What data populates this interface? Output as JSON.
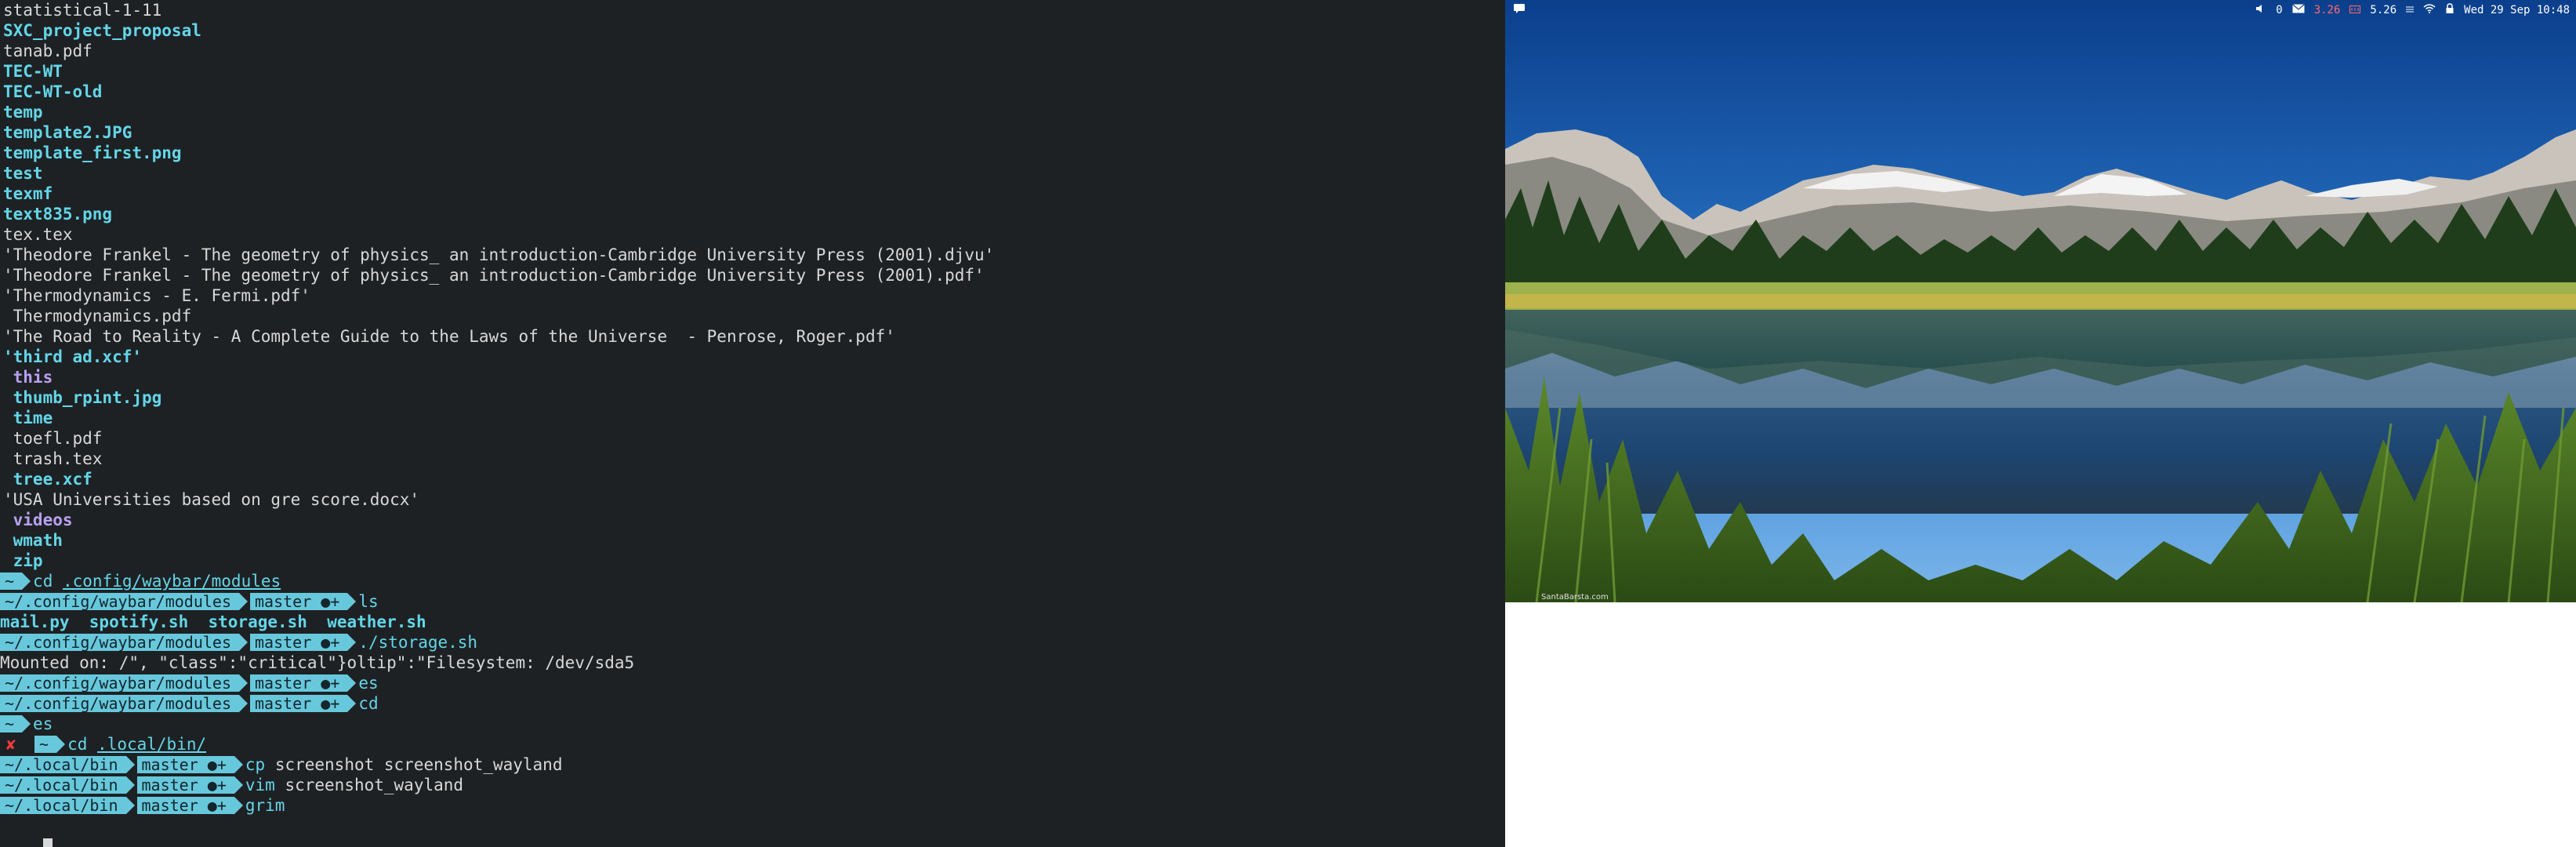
{
  "terminal": {
    "listing": [
      {
        "text": "statistical-1-11",
        "style": "white"
      },
      {
        "text": "SXC_project_proposal",
        "style": "dir"
      },
      {
        "text": "tanab.pdf",
        "style": "white"
      },
      {
        "text": "TEC-WT",
        "style": "dir"
      },
      {
        "text": "TEC-WT-old",
        "style": "dir"
      },
      {
        "text": "temp",
        "style": "dir"
      },
      {
        "text": "template2.JPG",
        "style": "dir"
      },
      {
        "text": "template_first.png",
        "style": "dir"
      },
      {
        "text": "test",
        "style": "dir"
      },
      {
        "text": "texmf",
        "style": "dir"
      },
      {
        "text": "text835.png",
        "style": "dir"
      },
      {
        "text": "tex.tex",
        "style": "white"
      },
      {
        "text": "'Theodore Frankel - The geometry of physics_ an introduction-Cambridge University Press (2001).djvu'",
        "style": "white"
      },
      {
        "text": "'Theodore Frankel - The geometry of physics_ an introduction-Cambridge University Press (2001).pdf'",
        "style": "white"
      },
      {
        "text": "'Thermodynamics - E. Fermi.pdf'",
        "style": "white"
      },
      {
        "text": " Thermodynamics.pdf",
        "style": "white"
      },
      {
        "text": "'The Road to Reality - A Complete Guide to the Laws of the Universe  - Penrose, Roger.pdf'",
        "style": "white"
      },
      {
        "text": "'third ad.xcf'",
        "style": "dir"
      },
      {
        "text": " this",
        "style": "dirp"
      },
      {
        "text": " thumb_rpint.jpg",
        "style": "dir"
      },
      {
        "text": " time",
        "style": "dir"
      },
      {
        "text": " toefl.pdf",
        "style": "white"
      },
      {
        "text": " trash.tex",
        "style": "white"
      },
      {
        "text": " tree.xcf",
        "style": "dir"
      },
      {
        "text": "'USA Universities based on gre score.docx'",
        "style": "white"
      },
      {
        "text": " videos",
        "style": "dirp"
      },
      {
        "text": " wmath",
        "style": "dir"
      },
      {
        "text": " zip",
        "style": "dir"
      }
    ],
    "session": {
      "p1_dir": "~",
      "p1_cmd": "cd",
      "p1_arg": ".config/waybar/modules",
      "p2_dir": "~/.config/waybar/modules",
      "p2_branch": "master ●+",
      "p2_cmd": "ls",
      "ls_output": "mail.py  spotify.sh  storage.sh  weather.sh",
      "p3_dir": "~/.config/waybar/modules",
      "p3_branch": "master ●+",
      "p3_cmd": "./storage.sh",
      "storage_output": "Mounted on: /\", \"class\":\"critical\"}oltip\":\"Filesystem: /dev/sda5",
      "p4_dir": "~/.config/waybar/modules",
      "p4_branch": "master ●+",
      "p4_cmd": "es",
      "p5_dir": "~/.config/waybar/modules",
      "p5_branch": "master ●+",
      "p5_cmd": "cd",
      "p6_dir": "~",
      "p6_cmd": "es",
      "p7_err": "✘",
      "p7_dir": "~",
      "p7_cmd": "cd",
      "p7_arg": ".local/bin/",
      "p8_dir": "~/.local/bin",
      "p8_branch": "master ●+",
      "p8_cmd": "cp",
      "p8_args": " screenshot screenshot_wayland",
      "p9_dir": "~/.local/bin",
      "p9_branch": "master ●+",
      "p9_cmd": "vim",
      "p9_args": " screenshot_wayland",
      "p10_dir": "~/.local/bin",
      "p10_branch": "master ●+",
      "p10_cmd": "grim"
    }
  },
  "statusbar": {
    "volume": "0",
    "mail_count": "",
    "cpu_warn": "3.26",
    "disk": "5.26",
    "datetime": "Wed 29 Sep 10:48"
  },
  "desktop": {
    "credit": "SantaBarsta.com"
  },
  "colors": {
    "terminal_bg": "#1e2124",
    "prompt_segment": "#67c8dc",
    "dir_cyan": "#63d6e8",
    "dir_purple": "#b7a0ef",
    "error_red": "#ff3b3b"
  }
}
